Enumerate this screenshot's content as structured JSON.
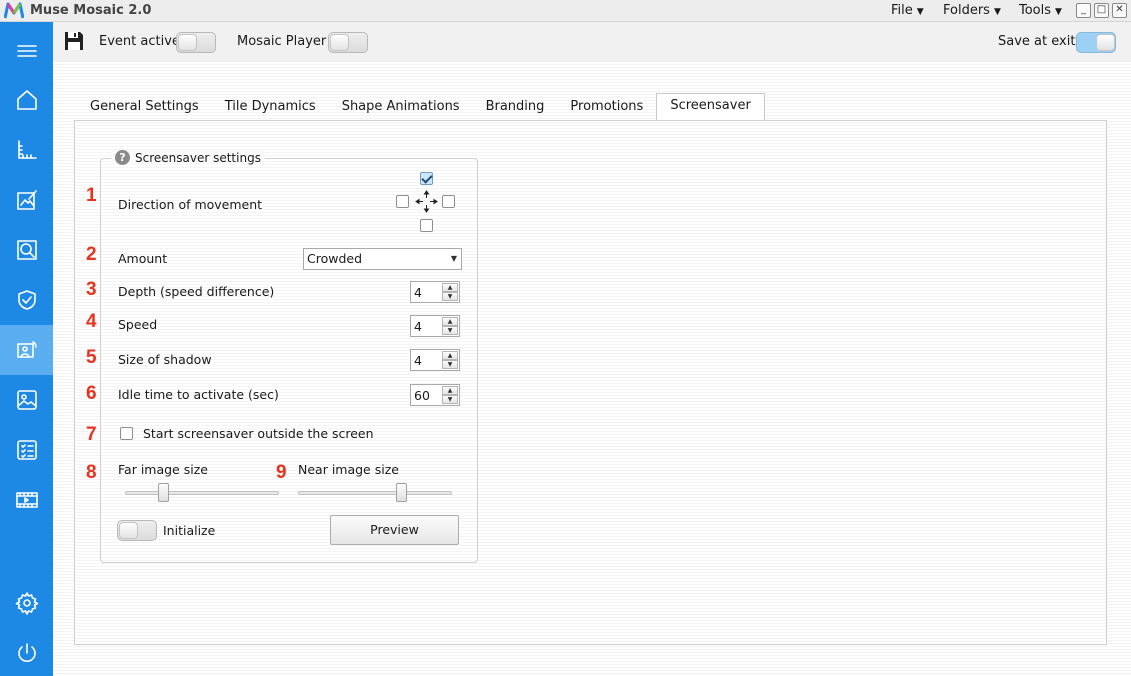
{
  "app": {
    "title": "Muse Mosaic 2.0",
    "menus": [
      "File",
      "Folders",
      "Tools"
    ],
    "window_buttons": [
      "_",
      "□",
      "✕"
    ]
  },
  "toolbar": {
    "event_active_label": "Event active",
    "event_active_on": false,
    "mosaic_player_label": "Mosaic Player",
    "mosaic_player_on": false,
    "save_at_exit_label": "Save at exit",
    "save_at_exit_on": true
  },
  "sidebar": {
    "items": [
      "menu-icon",
      "home-icon",
      "ruler-icon",
      "edit-image-icon",
      "search-image-icon",
      "shield-icon",
      "screensaver-icon",
      "photo-icon",
      "checklist-icon",
      "film-icon",
      "settings-icon",
      "power-icon"
    ],
    "active": "screensaver-icon"
  },
  "tabs": [
    "General Settings",
    "Tile Dynamics",
    "Shape Animations",
    "Branding",
    "Promotions",
    "Screensaver"
  ],
  "active_tab": "Screensaver",
  "screensaver": {
    "group_title": "Screensaver settings",
    "help_icon": "?",
    "direction": {
      "number": "1",
      "label": "Direction of movement",
      "up": true,
      "left": false,
      "right": false,
      "down": false
    },
    "amount": {
      "number": "2",
      "label": "Amount",
      "value": "Crowded"
    },
    "depth": {
      "number": "3",
      "label": "Depth (speed difference)",
      "value": "4"
    },
    "speed": {
      "number": "4",
      "label": "Speed",
      "value": "4"
    },
    "shadow": {
      "number": "5",
      "label": "Size of shadow",
      "value": "4"
    },
    "idle": {
      "number": "6",
      "label": "Idle time to activate (sec)",
      "value": "60"
    },
    "outside": {
      "number": "7",
      "label": "Start screensaver outside the screen",
      "checked": false
    },
    "far_size": {
      "number": "8",
      "label": "Far image size",
      "level_percent": 25
    },
    "near_size": {
      "number": "9",
      "label": "Near image size",
      "level_percent": 67
    },
    "initialize_label": "Initialize",
    "initialize_on": false,
    "preview_label": "Preview"
  },
  "colors": {
    "sidebar": "#1e88e5",
    "sidebar_active": "#5aaef0",
    "step_numbers": "#e8321c"
  }
}
